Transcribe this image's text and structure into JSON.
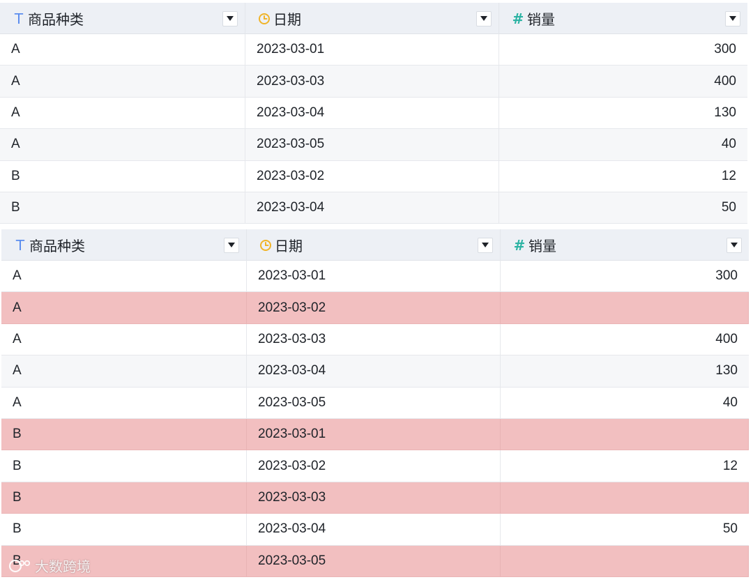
{
  "tables": [
    {
      "columns": [
        {
          "icon": "text-type-icon",
          "label": "商品种类"
        },
        {
          "icon": "date-type-icon",
          "label": "日期"
        },
        {
          "icon": "number-type-icon",
          "label": "销量"
        }
      ],
      "rows": [
        {
          "category": "A",
          "date": "2023-03-01",
          "sales": "300",
          "highlight": false
        },
        {
          "category": "A",
          "date": "2023-03-03",
          "sales": "400",
          "highlight": false
        },
        {
          "category": "A",
          "date": "2023-03-04",
          "sales": "130",
          "highlight": false
        },
        {
          "category": "A",
          "date": "2023-03-05",
          "sales": "40",
          "highlight": false
        },
        {
          "category": "B",
          "date": "2023-03-02",
          "sales": "12",
          "highlight": false
        },
        {
          "category": "B",
          "date": "2023-03-04",
          "sales": "50",
          "highlight": false
        }
      ]
    },
    {
      "columns": [
        {
          "icon": "text-type-icon",
          "label": "商品种类"
        },
        {
          "icon": "date-type-icon",
          "label": "日期"
        },
        {
          "icon": "number-type-icon",
          "label": "销量"
        }
      ],
      "rows": [
        {
          "category": "A",
          "date": "2023-03-01",
          "sales": "300",
          "highlight": false
        },
        {
          "category": "A",
          "date": "2023-03-02",
          "sales": "",
          "highlight": true
        },
        {
          "category": "A",
          "date": "2023-03-03",
          "sales": "400",
          "highlight": false
        },
        {
          "category": "A",
          "date": "2023-03-04",
          "sales": "130",
          "highlight": false
        },
        {
          "category": "A",
          "date": "2023-03-05",
          "sales": "40",
          "highlight": false
        },
        {
          "category": "B",
          "date": "2023-03-01",
          "sales": "",
          "highlight": true
        },
        {
          "category": "B",
          "date": "2023-03-02",
          "sales": "12",
          "highlight": false
        },
        {
          "category": "B",
          "date": "2023-03-03",
          "sales": "",
          "highlight": true
        },
        {
          "category": "B",
          "date": "2023-03-04",
          "sales": "50",
          "highlight": false
        },
        {
          "category": "B",
          "date": "2023-03-05",
          "sales": "",
          "highlight": true
        }
      ]
    }
  ],
  "colors": {
    "header_bg": "#edf0f5",
    "highlight_row": "#f2bfc0",
    "text_icon": "#5b8def",
    "date_icon": "#f0b429",
    "number_icon": "#2bb3a3"
  },
  "watermark": {
    "logo": "watermark-logo-icon",
    "text": "大数跨境"
  }
}
